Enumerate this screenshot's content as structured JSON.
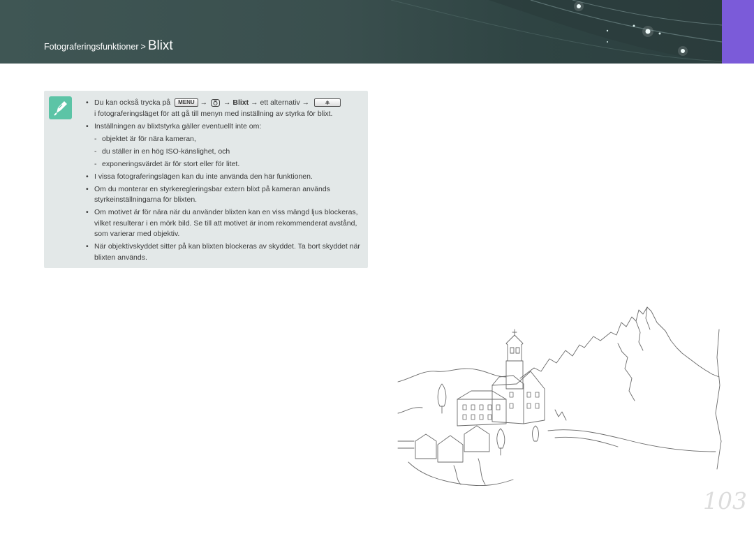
{
  "header": {
    "section": "Fotograferingsfunktioner",
    "separator": ">",
    "current": "Blixt"
  },
  "note": {
    "icon": "pencil-note-icon",
    "line1": {
      "pre": "Du kan också trycka på",
      "menu_button": "MENU",
      "arrow1": "→",
      "arrow2": "→",
      "bold": "Blixt",
      "mid": "→ ett alternativ →",
      "cont": "i fotograferingsläget för att gå till menyn med inställning av styrka för blixt."
    },
    "bullets": [
      "Inställningen av blixtstyrka gäller eventuellt inte om:",
      "I vissa fotograferingslägen kan du inte använda den här funktionen.",
      "Om du monterar en styrkeregleringsbar extern blixt på kameran används styrkeinställningarna för blixten.",
      "Om motivet är för nära när du använder blixten kan en viss mängd ljus blockeras, vilket resulterar i en mörk bild. Se till att motivet är inom rekommenderat avstånd, som varierar med objektiv.",
      "När objektivskyddet sitter på kan blixten blockeras av skyddet. Ta bort skyddet när blixten används."
    ],
    "sub_bullets": [
      "objektet är för nära kameran,",
      "du ställer in en hög ISO-känslighet, och",
      "exponeringsvärdet är för stort eller för litet."
    ]
  },
  "page_number": "103",
  "colors": {
    "header_bg": "#3a4f4e",
    "accent_tab": "#7b5bd9",
    "note_bg": "#e3e8e8",
    "note_icon": "#5cc4a6"
  }
}
